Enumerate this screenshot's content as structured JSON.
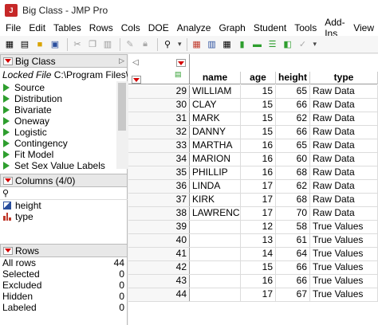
{
  "window": {
    "title": "Big Class - JMP Pro"
  },
  "menu": [
    "File",
    "Edit",
    "Tables",
    "Rows",
    "Cols",
    "DOE",
    "Analyze",
    "Graph",
    "Student",
    "Tools",
    "Add-Ins",
    "View"
  ],
  "source_panel": {
    "title": "Big Class",
    "locked_label": "Locked File",
    "locked_path": "C:\\Program Files\\",
    "scripts": [
      "Source",
      "Distribution",
      "Bivariate",
      "Oneway",
      "Logistic",
      "Contingency",
      "Fit Model",
      "Set Sex Value Labels"
    ]
  },
  "columns_panel": {
    "title": "Columns (4/0)",
    "columns": [
      {
        "name": "height",
        "icon": "continuous-icon"
      },
      {
        "name": "type",
        "icon": "nominal-icon"
      }
    ]
  },
  "rows_panel": {
    "title": "Rows",
    "stats": [
      {
        "label": "All rows",
        "value": "44"
      },
      {
        "label": "Selected",
        "value": "0"
      },
      {
        "label": "Excluded",
        "value": "0"
      },
      {
        "label": "Hidden",
        "value": "0"
      },
      {
        "label": "Labeled",
        "value": "0"
      }
    ]
  },
  "table": {
    "headers": [
      "name",
      "age",
      "height",
      "type"
    ],
    "rows": [
      [
        "29",
        "WILLIAM",
        "15",
        "65",
        "Raw Data"
      ],
      [
        "30",
        "CLAY",
        "15",
        "66",
        "Raw Data"
      ],
      [
        "31",
        "MARK",
        "15",
        "62",
        "Raw Data"
      ],
      [
        "32",
        "DANNY",
        "15",
        "66",
        "Raw Data"
      ],
      [
        "33",
        "MARTHA",
        "16",
        "65",
        "Raw Data"
      ],
      [
        "34",
        "MARION",
        "16",
        "60",
        "Raw Data"
      ],
      [
        "35",
        "PHILLIP",
        "16",
        "68",
        "Raw Data"
      ],
      [
        "36",
        "LINDA",
        "17",
        "62",
        "Raw Data"
      ],
      [
        "37",
        "KIRK",
        "17",
        "68",
        "Raw Data"
      ],
      [
        "38",
        "LAWRENCE",
        "17",
        "70",
        "Raw Data"
      ],
      [
        "39",
        "",
        "12",
        "58",
        "True Values"
      ],
      [
        "40",
        "",
        "13",
        "61",
        "True Values"
      ],
      [
        "41",
        "",
        "14",
        "64",
        "True Values"
      ],
      [
        "42",
        "",
        "15",
        "66",
        "True Values"
      ],
      [
        "43",
        "",
        "16",
        "66",
        "True Values"
      ],
      [
        "44",
        "",
        "17",
        "67",
        "True Values"
      ]
    ]
  },
  "colors": {
    "accent": "#d40000",
    "script_green": "#2e9e2e",
    "continuous_blue": "#2a4f9e",
    "nominal_red": "#c0392b"
  }
}
